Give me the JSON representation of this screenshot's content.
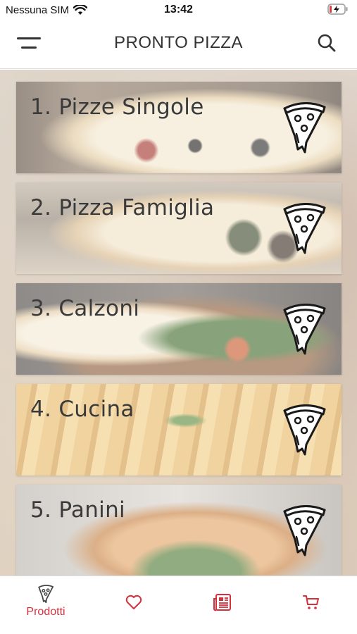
{
  "status_bar": {
    "carrier": "Nessuna SIM",
    "time": "13:42"
  },
  "header": {
    "title": "PRONTO PIZZA",
    "menu_icon": "hamburger-menu-icon",
    "search_icon": "search-icon"
  },
  "categories": [
    {
      "label": "1. Pizze Singole",
      "icon": "pizza-slice-icon"
    },
    {
      "label": "2. Pizza Famiglia",
      "icon": "pizza-slice-icon"
    },
    {
      "label": "3. Calzoni",
      "icon": "pizza-slice-icon"
    },
    {
      "label": "4. Cucina",
      "icon": "pizza-slice-icon"
    },
    {
      "label": "5. Panini",
      "icon": "pizza-slice-icon"
    }
  ],
  "tab_bar": {
    "items": [
      {
        "label": "Prodotti",
        "icon": "pizza-slice-icon",
        "active": true
      },
      {
        "label": "",
        "icon": "heart-icon",
        "active": false
      },
      {
        "label": "",
        "icon": "newspaper-icon",
        "active": false
      },
      {
        "label": "",
        "icon": "cart-icon",
        "active": false
      }
    ]
  },
  "colors": {
    "accent": "#d6303d",
    "text": "#333333"
  }
}
